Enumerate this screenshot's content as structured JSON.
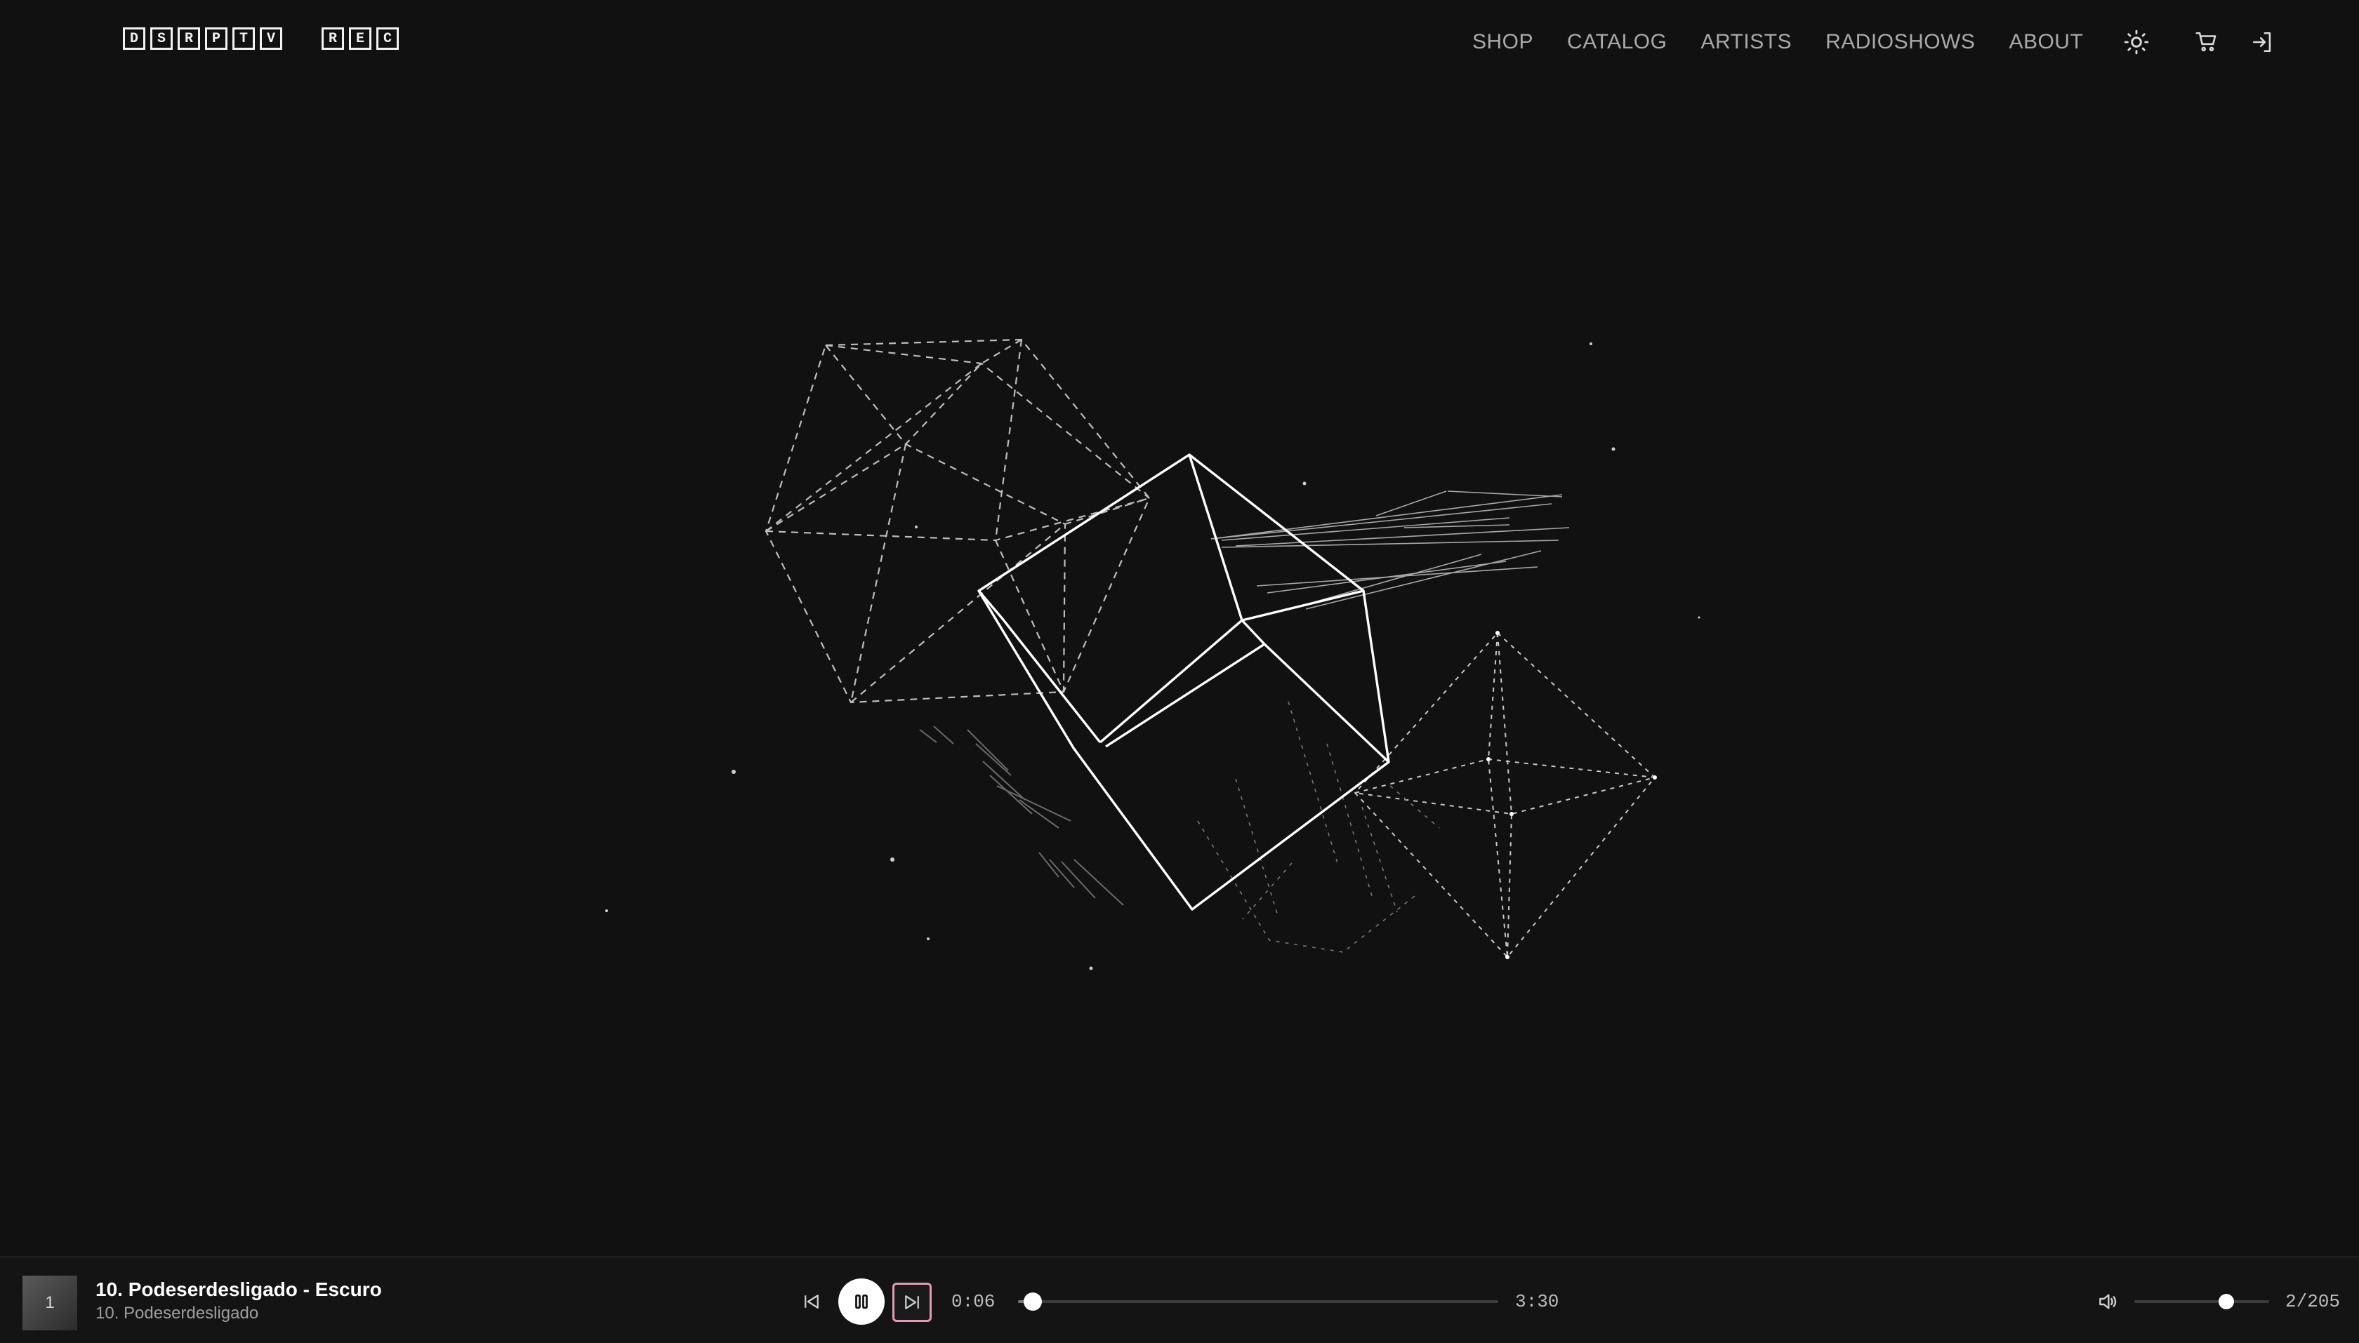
{
  "logo": {
    "word1": [
      "D",
      "S",
      "R",
      "P",
      "T",
      "V"
    ],
    "word2": [
      "R",
      "E",
      "C"
    ]
  },
  "nav": {
    "shop": "SHOP",
    "catalog": "CATALOG",
    "artists": "ARTISTS",
    "radioshows": "RADIOSHOWS",
    "about": "ABOUT",
    "icons": [
      "sun-icon",
      "cart-icon",
      "login-icon"
    ]
  },
  "player": {
    "cover_label": "1",
    "track_title": "10. Podeserdesligado - Escuro",
    "track_subtitle": "10. Podeserdesligado",
    "current_time": "0:06",
    "duration": "3:30",
    "progress_fraction": 0.03,
    "volume_fraction": 0.68,
    "playlist_position": "2/205",
    "state": "playing",
    "icons": [
      "skip-back-icon",
      "pause-icon",
      "skip-forward-icon",
      "volume-icon"
    ]
  },
  "colors": {
    "background": "#111111",
    "text_primary": "#ffffff",
    "nav_text": "#a9a9a9",
    "next_button_border": "#e39ab6"
  }
}
